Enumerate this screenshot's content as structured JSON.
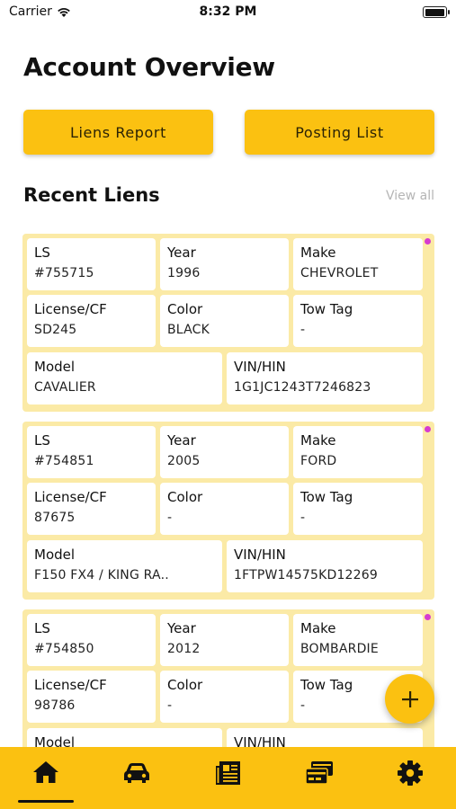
{
  "status_bar": {
    "carrier": "Carrier",
    "time": "8:32 PM",
    "battery_level": 1.0
  },
  "header": {
    "title": "Account Overview"
  },
  "actions": {
    "liens_report": "Liens Report",
    "posting_list": "Posting List"
  },
  "recent": {
    "title": "Recent Liens",
    "view_all": "View all"
  },
  "labels": {
    "ls": "LS",
    "year": "Year",
    "make": "Make",
    "license": "License/CF",
    "color": "Color",
    "tow_tag": "Tow Tag",
    "model": "Model",
    "vin": "VIN/HIN"
  },
  "liens": [
    {
      "ls": "#755715",
      "year": "1996",
      "make": "CHEVROLET",
      "license": "SD245",
      "color": "BLACK",
      "tow_tag": "-",
      "model": "CAVALIER",
      "vin": "1G1JC1243T7246823"
    },
    {
      "ls": "#754851",
      "year": "2005",
      "make": "FORD",
      "license": "87675",
      "color": "-",
      "tow_tag": "-",
      "model": "F150 FX4 / KING RA..",
      "vin": "1FTPW14575KD12269"
    },
    {
      "ls": "#754850",
      "year": "2012",
      "make": "BOMBARDIE",
      "license": "98786",
      "color": "-",
      "tow_tag": "-",
      "model": "",
      "vin": ""
    }
  ],
  "fab": {
    "icon": "plus-icon"
  },
  "bottom_nav": [
    "home-icon",
    "car-icon",
    "newspaper-icon",
    "payment-card-icon",
    "gear-icon"
  ],
  "colors": {
    "accent": "#FBC111",
    "card_bg": "#FBEAA6",
    "dot": "#d63cd0",
    "muted": "#b5b5b5"
  }
}
